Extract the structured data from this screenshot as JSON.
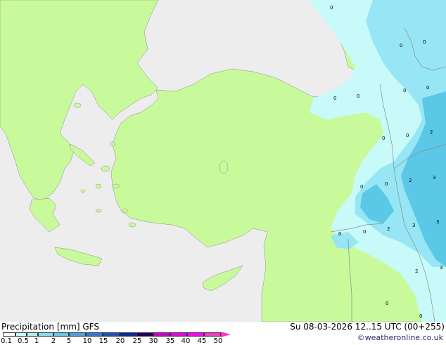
{
  "map_labels": {
    "values": [
      "0",
      "0",
      "0",
      "0",
      "0",
      "0",
      "0",
      "0",
      "2",
      "2",
      "3",
      "0",
      "0",
      "2",
      "3",
      "0",
      "0",
      "2",
      "3",
      "3",
      "0",
      "0",
      "0"
    ]
  },
  "footer": {
    "title": "Precipitation [mm]  GFS",
    "datetime": "Su 08-03-2026 12..15 UTC (00+255)",
    "credit": "©weatheronline.co.uk"
  },
  "legend": {
    "ticks": [
      "0.1",
      "0.5",
      "1",
      "2",
      "5",
      "10",
      "15",
      "20",
      "25",
      "30",
      "35",
      "40",
      "45",
      "50"
    ],
    "colors": [
      "#ffffff",
      "#c8fafa",
      "#aaf0f5",
      "#82dcf0",
      "#64c8e6",
      "#4ba0dc",
      "#3278d2",
      "#1e50be",
      "#0a2896",
      "#1e0064",
      "#c800c8",
      "#e600e6",
      "#ff00ff",
      "#ff32c8"
    ]
  },
  "colors": {
    "sea": "#ededed",
    "land": "#c8fa9b",
    "border": "#8c8c8c",
    "precip_light": "#c8fafa",
    "precip_mid": "#96e6f5",
    "precip_heavy": "#5ac8e6"
  }
}
